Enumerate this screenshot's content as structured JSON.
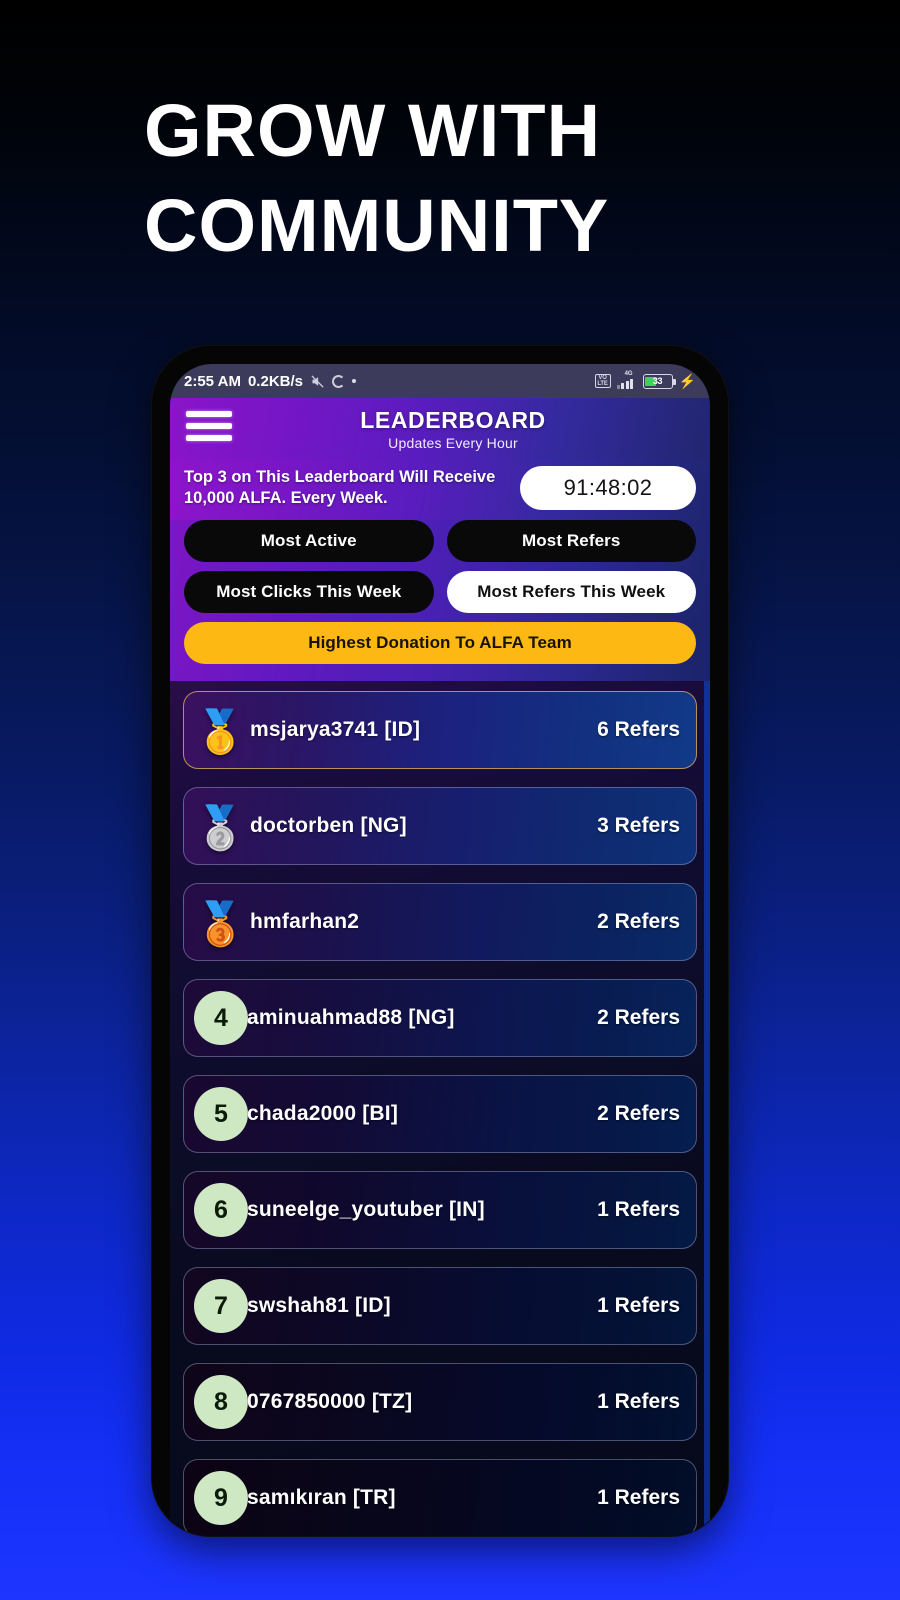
{
  "headline": {
    "line1": "GROW WITH",
    "line2": "COMMUNITY"
  },
  "statusbar": {
    "time": "2:55 AM",
    "network_speed": "0.2KB/s",
    "mute_icon": "mute-icon",
    "loading_icon": "loading-circle-icon",
    "dot_icon": "dot-icon",
    "volte_label": "VO\nLTE",
    "volte_line1": "VO",
    "volte_line2": "LTE",
    "network_type": "4G",
    "battery_percent": "33",
    "charging_icon": "charging-bolt-icon"
  },
  "appbar": {
    "menu_icon": "hamburger-menu-icon",
    "title": "LEADERBOARD",
    "subtitle": "Updates Every Hour"
  },
  "promo": {
    "text": "Top 3 on This Leaderboard Will Receive 10,000 ALFA. Every Week.",
    "countdown": "91:48:02"
  },
  "filters": {
    "most_active": "Most Active",
    "most_refers": "Most Refers",
    "most_clicks_week": "Most Clicks This Week",
    "most_refers_week": "Most Refers This Week",
    "highest_donation": "Highest Donation To ALFA Team",
    "active_filter": "Most Refers This Week"
  },
  "colors": {
    "accent_gold": "#fdb813",
    "rank_circle": "#cfe8c4",
    "battery_green": "#3fd25a",
    "page_bottom_blue": "#1d35ff"
  },
  "leaderboard": {
    "rows": [
      {
        "rank": "1",
        "badge": "gold-medal-icon",
        "medal": "🥇",
        "username": "msjarya3741 [ID]",
        "refers": "6 Refers"
      },
      {
        "rank": "2",
        "badge": "silver-medal-icon",
        "medal": "🥈",
        "username": "doctorben [NG]",
        "refers": "3 Refers"
      },
      {
        "rank": "3",
        "badge": "bronze-medal-icon",
        "medal": "🥉",
        "username": "hmfarhan2",
        "refers": "2 Refers"
      },
      {
        "rank": "4",
        "badge": "rank-number",
        "medal": "",
        "username": "aminuahmad88 [NG]",
        "refers": "2 Refers"
      },
      {
        "rank": "5",
        "badge": "rank-number",
        "medal": "",
        "username": "chada2000 [BI]",
        "refers": "2 Refers"
      },
      {
        "rank": "6",
        "badge": "rank-number",
        "medal": "",
        "username": "suneelge_youtuber [IN]",
        "refers": "1 Refers"
      },
      {
        "rank": "7",
        "badge": "rank-number",
        "medal": "",
        "username": "swshah81 [ID]",
        "refers": "1 Refers"
      },
      {
        "rank": "8",
        "badge": "rank-number",
        "medal": "",
        "username": "0767850000 [TZ]",
        "refers": "1 Refers"
      },
      {
        "rank": "9",
        "badge": "rank-number",
        "medal": "",
        "username": "samıkıran [TR]",
        "refers": "1 Refers"
      }
    ]
  }
}
